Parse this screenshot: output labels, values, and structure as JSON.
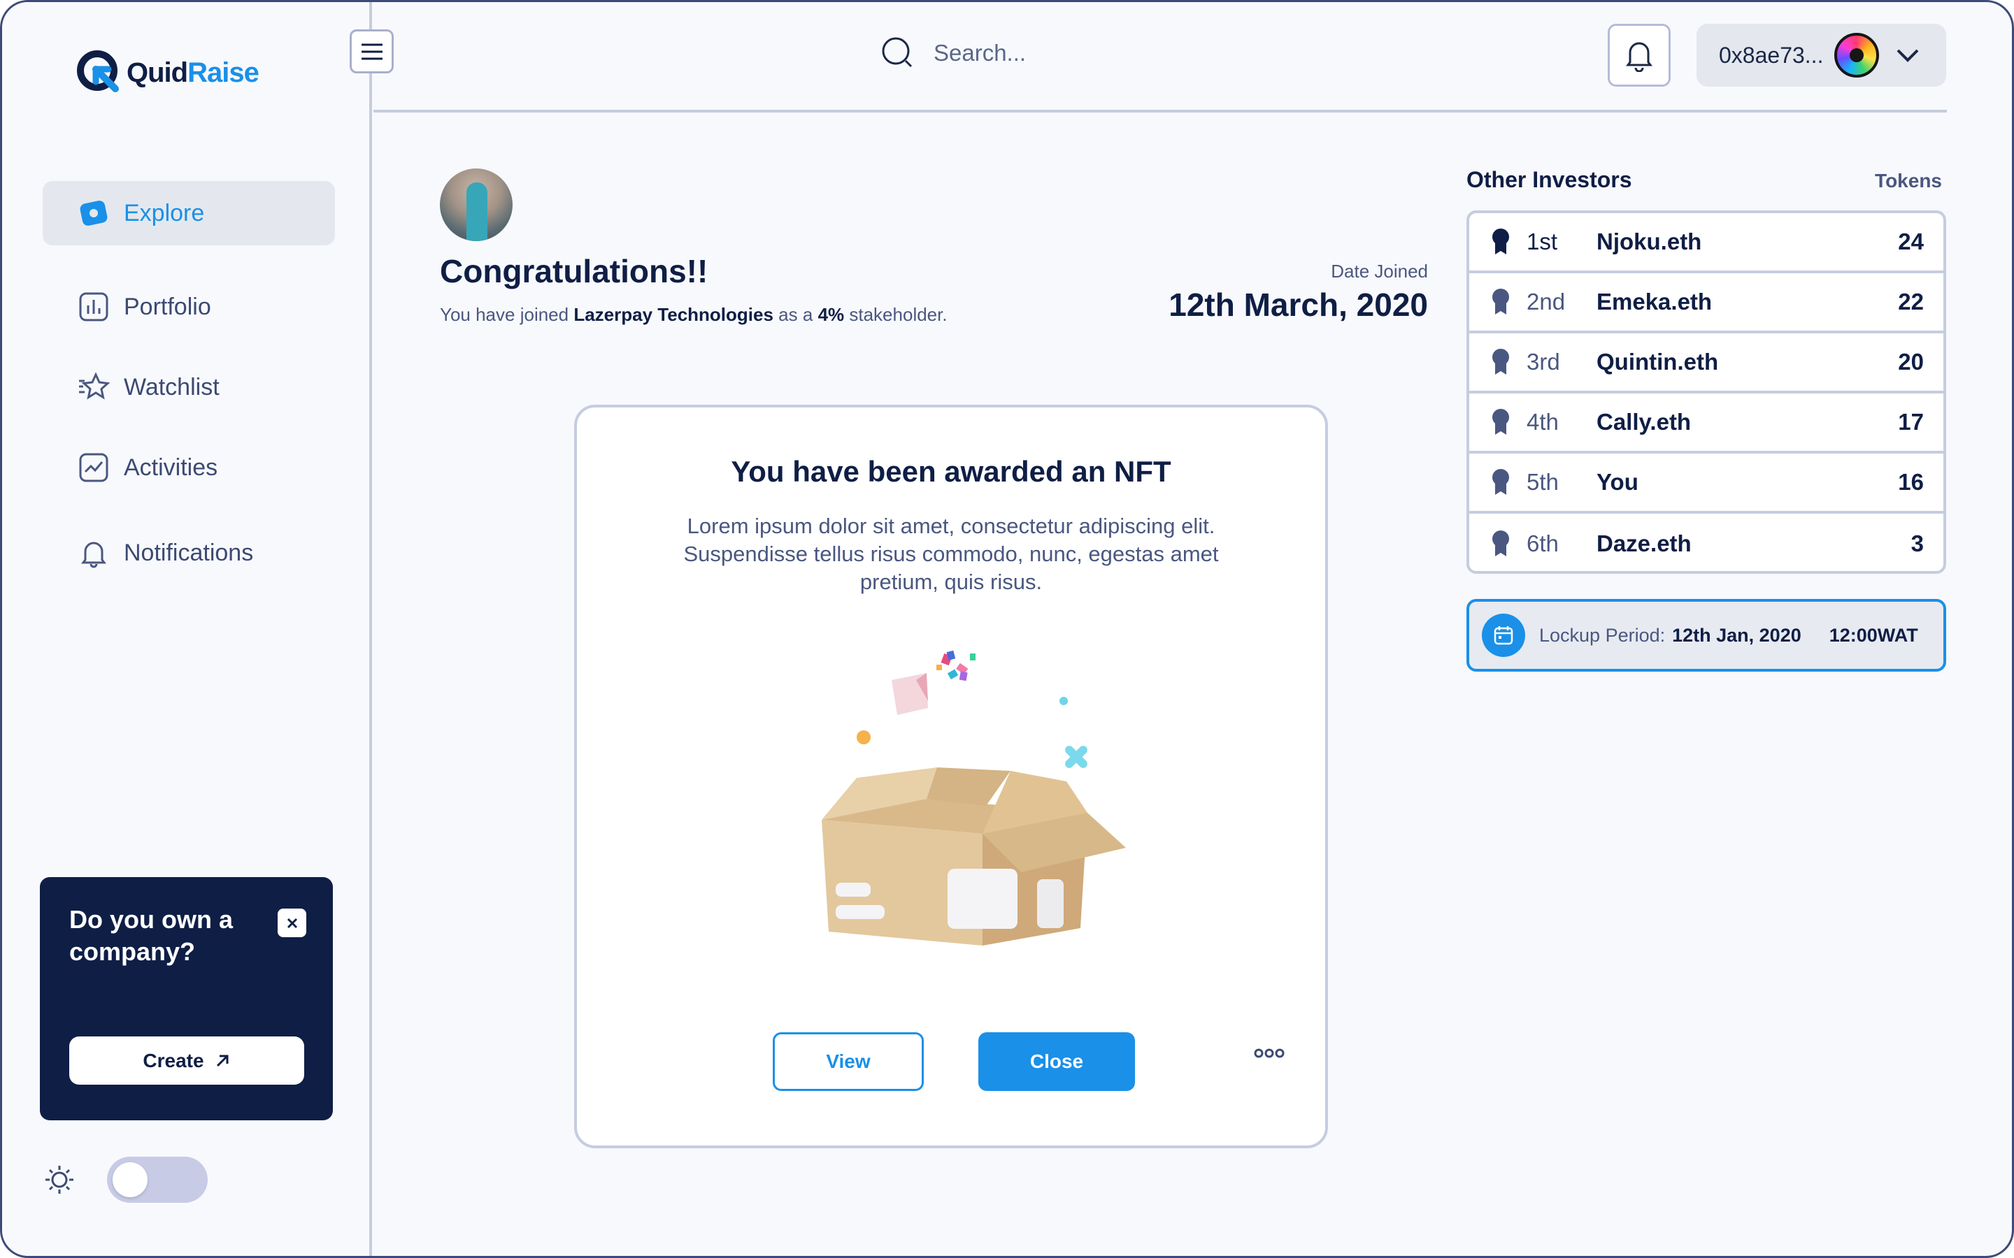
{
  "app": {
    "logo_part1": "Quid",
    "logo_part2": "Raise",
    "brand_color": "#1a90e8",
    "navy_color": "#0f1e45"
  },
  "sidebar": {
    "items": [
      {
        "label": "Explore",
        "icon": "explore-icon",
        "active": true
      },
      {
        "label": "Portfolio",
        "icon": "portfolio-icon",
        "active": false
      },
      {
        "label": "Watchlist",
        "icon": "star-icon",
        "active": false
      },
      {
        "label": "Activities",
        "icon": "activity-chart-icon",
        "active": false
      },
      {
        "label": "Notifications",
        "icon": "bell-icon",
        "active": false
      }
    ],
    "promo": {
      "text": "Do you own a company?",
      "button": "Create"
    },
    "theme": {
      "icon": "sun-icon",
      "dark_mode": false
    }
  },
  "header": {
    "search_placeholder": "Search...",
    "wallet_address": "0x8ae73..."
  },
  "congrats": {
    "title": "Congratulations!!",
    "sub_prefix": "You have joined",
    "company": "Lazerpay Technologies",
    "sub_mid": "as a",
    "stake": "4%",
    "sub_suffix": "stakeholder.",
    "date_label": "Date Joined",
    "date_value": "12th March, 2020"
  },
  "modal": {
    "title": "You have been awarded an NFT",
    "body": "Lorem ipsum dolor sit amet, consectetur adipiscing elit. Suspendisse tellus risus commodo, nunc, egestas amet pretium, quis risus.",
    "view_label": "View",
    "close_label": "Close"
  },
  "investors": {
    "title": "Other Investors",
    "tokens_label": "Tokens",
    "rows": [
      {
        "rank": "1st",
        "name": "Njoku.eth",
        "tokens": "24"
      },
      {
        "rank": "2nd",
        "name": "Emeka.eth",
        "tokens": "22"
      },
      {
        "rank": "3rd",
        "name": "Quintin.eth",
        "tokens": "20"
      },
      {
        "rank": "4th",
        "name": "Cally.eth",
        "tokens": "17"
      },
      {
        "rank": "5th",
        "name": "You",
        "tokens": "16"
      },
      {
        "rank": "6th",
        "name": "Daze.eth",
        "tokens": "3"
      }
    ]
  },
  "lockup": {
    "label": "Lockup Period:",
    "date": "12th Jan, 2020",
    "time": "12:00WAT"
  }
}
